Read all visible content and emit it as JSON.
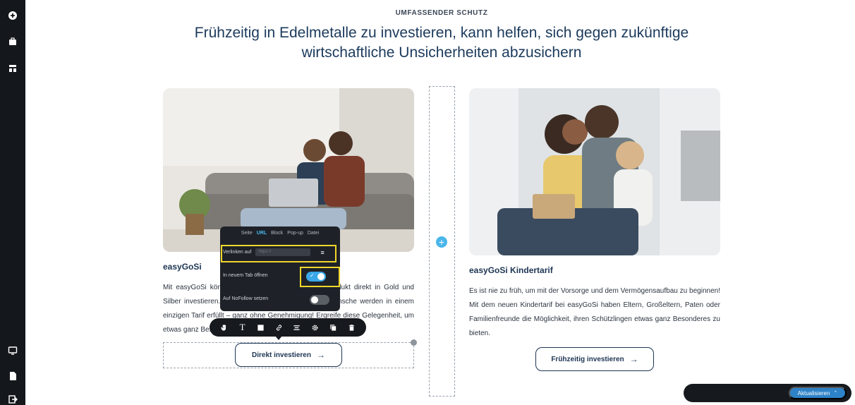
{
  "header": {
    "eyebrow": "UMFASSENDER SCHUTZ",
    "headline": "Frühzeitig in Edelmetalle zu investieren, kann helfen, sich gegen zukünftige wirtschaftliche Unsicherheiten abzusichern"
  },
  "sidebar": {
    "icons": [
      "add-icon",
      "briefcase-icon",
      "layout-icon",
      "desktop-icon",
      "page-icon",
      "logout-icon"
    ]
  },
  "card_left": {
    "title": "easyGoSi",
    "text": "Mit easyGoSi können Kunden in einem einzigen Produkt direkt in Gold und Silber investieren. Besonders ist, dass alle Kundenwünsche werden in einem einzigen Tarif erfüllt – ganz ohne Genehmigung! Ergreife diese Gelegenheit, um etwas ganz Besonderes tun.",
    "cta": "Direkt investieren"
  },
  "card_right": {
    "title": "easyGoSi Kindertarif",
    "text": "Es ist nie zu früh, um mit der Vorsorge und dem Vermögensaufbau zu beginnen! Mit dem neuen Kindertarif bei easyGoSi haben Eltern, Großeltern, Paten oder Familienfreunde die Möglichkeit, ihren Schützlingen etwas ganz Besonderes zu bieten.",
    "cta": "Frühzeitig investieren"
  },
  "popover": {
    "tabs": [
      "Seite",
      "URL",
      "Block",
      "Pop-up",
      "Datei"
    ],
    "active_tab": "URL",
    "link_label": "Verlinken auf",
    "link_placeholder": "https://",
    "new_tab_label": "In neuem Tab öffnen",
    "new_tab_on": true,
    "nofollow_label": "Auf NoFollow setzen",
    "nofollow_on": false
  },
  "element_toolbar": {
    "icons": [
      "hand-icon",
      "text-icon",
      "square-icon",
      "link-icon",
      "align-icon",
      "gear-icon",
      "copy-icon",
      "trash-icon"
    ]
  },
  "bottom_bar": {
    "icons": [
      "help-icon",
      "eye-off-icon",
      "undo-icon",
      "redo-icon",
      "external-link-icon"
    ],
    "update_label": "Aktualisieren"
  },
  "colors": {
    "accent": "#3aa8e8",
    "highlight": "#f3d62a",
    "navy": "#1d3553"
  }
}
